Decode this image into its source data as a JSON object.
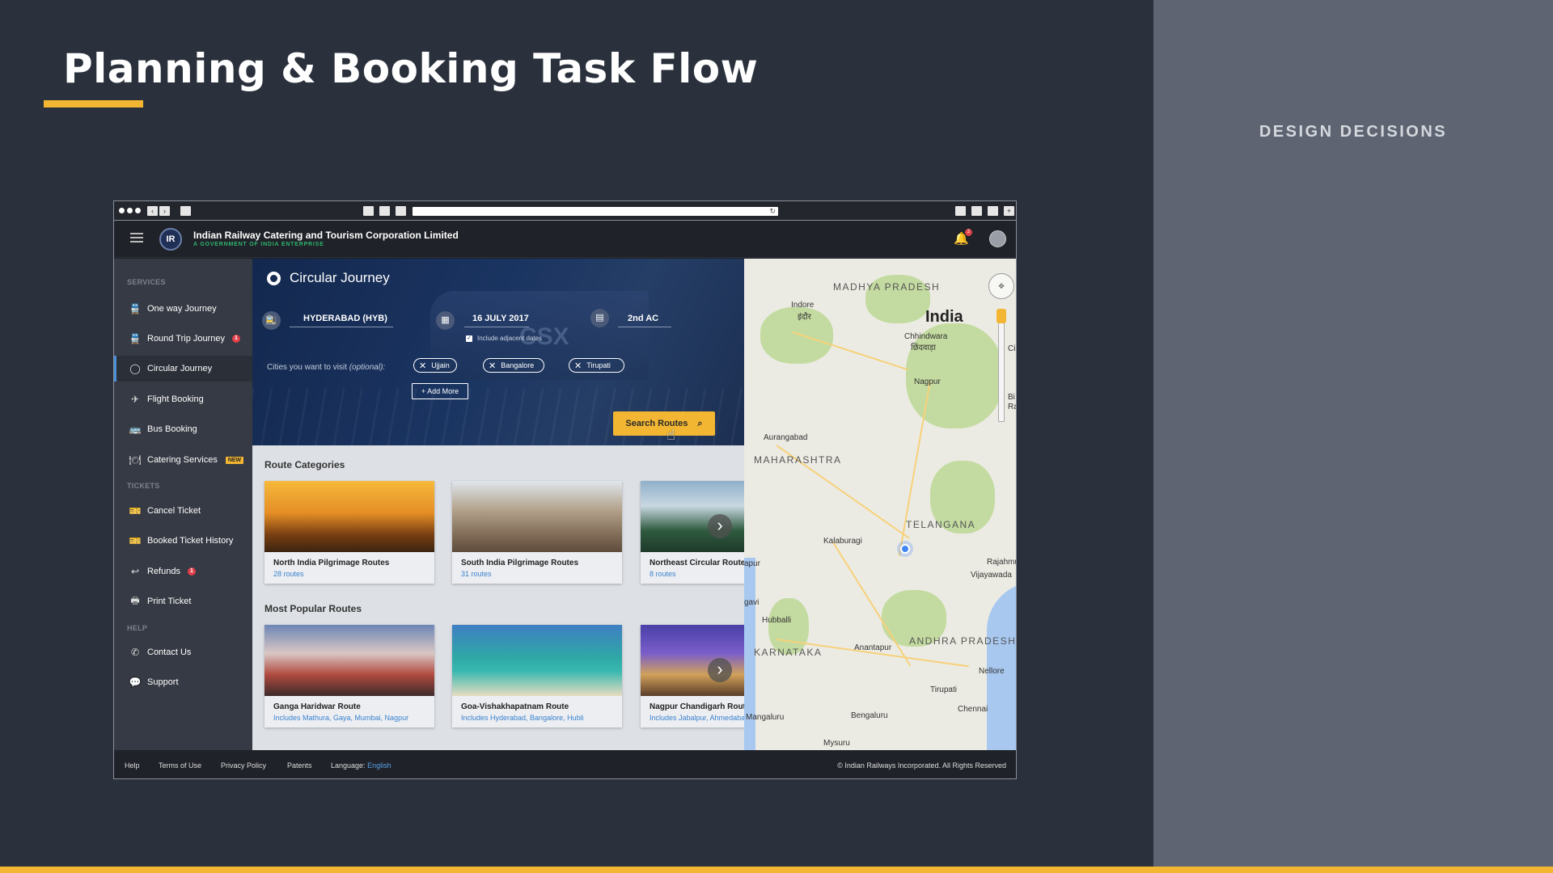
{
  "slide": {
    "title": "Planning & Booking Task Flow",
    "side_heading": "DESIGN DECISIONS"
  },
  "colors": {
    "accent": "#f2b632",
    "background": "#2a313c",
    "side_panel": "#5e6471",
    "link": "#3b82d0"
  },
  "app": {
    "org_name": "Indian Railway Catering and Tourism Corporation Limited",
    "org_tagline": "A GOVERNMENT OF INDIA ENTERPRISE",
    "notification_count": "2"
  },
  "sidebar": {
    "sections": [
      "SERVICES",
      "TICKETS",
      "HELP"
    ],
    "items": [
      {
        "label": "One way Journey",
        "icon": "train-icon"
      },
      {
        "label": "Round Trip Journey",
        "icon": "train-icon",
        "badge": "1"
      },
      {
        "label": "Circular Journey",
        "icon": "circle-icon"
      },
      {
        "label": "Flight Booking",
        "icon": "plane-icon"
      },
      {
        "label": "Bus Booking",
        "icon": "bus-icon"
      },
      {
        "label": "Catering Services",
        "icon": "catering-icon",
        "tag": "NEW"
      },
      {
        "label": "Cancel Ticket",
        "icon": "ticket-cancel-icon"
      },
      {
        "label": "Booked Ticket History",
        "icon": "ticket-history-icon"
      },
      {
        "label": "Refunds",
        "icon": "refund-icon",
        "badge": "1"
      },
      {
        "label": "Print Ticket",
        "icon": "printer-icon"
      },
      {
        "label": "Contact Us",
        "icon": "phone-icon"
      },
      {
        "label": "Support",
        "icon": "chat-icon"
      }
    ]
  },
  "search": {
    "title": "Circular Journey",
    "origin": "HYDERABAD (HYB)",
    "date": "16 JULY 2017",
    "class": "2nd AC",
    "adjacent_label": "Include adjacent dates",
    "cities_label": "Cities you want to visit",
    "cities_optional": "(optional):",
    "cities": [
      "Ujjain",
      "Bangalore",
      "Tirupati"
    ],
    "add_more": "+ Add More",
    "button": "Search Routes"
  },
  "route_categories": {
    "title": "Route Categories",
    "cards": [
      {
        "title": "North India Pilgrimage Routes",
        "sub": "28 routes"
      },
      {
        "title": "South India Pilgrimage Routes",
        "sub": "31 routes"
      },
      {
        "title": "Northeast Circular Routes",
        "sub": "8 routes"
      }
    ]
  },
  "popular_routes": {
    "title": "Most Popular Routes",
    "cards": [
      {
        "title": "Ganga Haridwar Route",
        "sub": "Includes Mathura, Gaya, Mumbai, Nagpur"
      },
      {
        "title": "Goa-Vishakhapatnam Route",
        "sub": "Includes Hyderabad, Bangalore, Hubli"
      },
      {
        "title": "Nagpur Chandigarh Route",
        "sub": "Includes Jabalpur, Ahmedabad"
      }
    ]
  },
  "map": {
    "country": "India",
    "states": [
      "MADHYA PRADESH",
      "MAHARASHTRA",
      "TELANGANA",
      "ANDHRA PRADESH",
      "KARNATAKA"
    ],
    "cities": [
      "Indore",
      "इंदौर",
      "Chhindwara",
      "छिंदवाड़ा",
      "Nagpur",
      "Aurangabad",
      "Kalaburagi",
      "Hubballi",
      "Anantapur",
      "Tirupati",
      "Nellore",
      "Bengaluru",
      "Chennai",
      "Mysuru",
      "Vijayawada",
      "Mangaluru",
      "Rajahmu",
      "apur",
      "Ci",
      "Bi",
      "Ra",
      "gavi"
    ]
  },
  "footer": {
    "links": [
      "Help",
      "Terms of Use",
      "Privacy Policy",
      "Patents"
    ],
    "language_label": "Language:",
    "language_value": "English",
    "copyright": "© Indian Railways Incorporated. All Rights Reserved"
  }
}
